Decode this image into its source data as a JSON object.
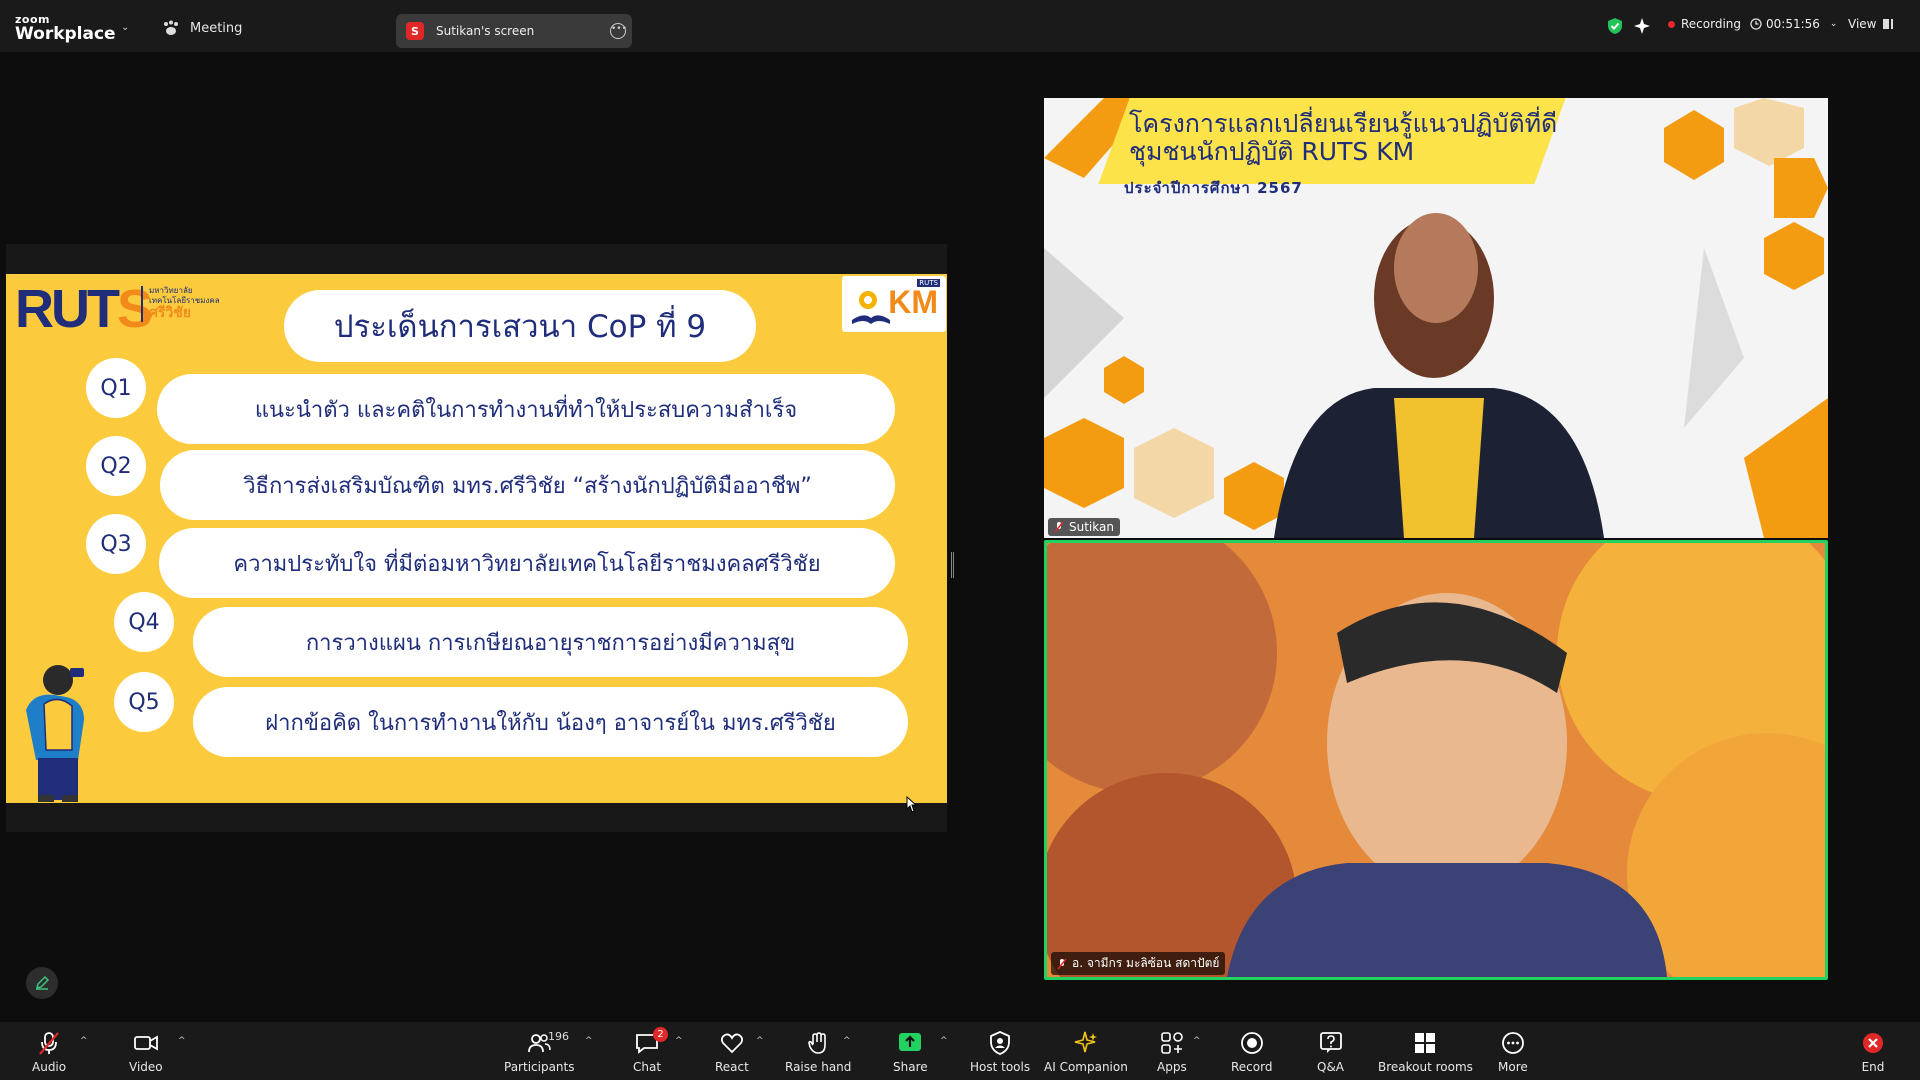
{
  "topbar": {
    "brand_small": "zoom",
    "brand_big": "Workplace",
    "meeting_label": "Meeting",
    "share_badge": "S",
    "share_label": "Sutikan's screen",
    "recording_label": "Recording",
    "timer": "00:51:56",
    "view_label": "View"
  },
  "slide": {
    "logo": "RUT",
    "logo_s": "S",
    "logo_sub1": "มหาวิทยาลัย",
    "logo_sub2": "เทคโนโลยีราชมงคล",
    "logo_sub3": "ศรีวิชัย",
    "km_tag": "RUTS",
    "km_text": "KM",
    "title": "ประเด็นการเสวนา CoP ที่ 9",
    "questions": [
      {
        "label": "Q1",
        "text": "แนะนำตัว และคติในการทำงานที่ทำให้ประสบความสำเร็จ"
      },
      {
        "label": "Q2",
        "text": "วิธีการส่งเสริมบัณฑิต มทร.ศรีวิชัย “สร้างนักปฏิบัติมืออาชีพ”"
      },
      {
        "label": "Q3",
        "text": "ความประทับใจ ที่มีต่อมหาวิทยาลัยเทคโนโลยีราชมงคลศรีวิชัย"
      },
      {
        "label": "Q4",
        "text": "การวางแผน การเกษียณอายุราชการอย่างมีความสุข"
      },
      {
        "label": "Q5",
        "text": "ฝากข้อคิด ในการทำงานให้กับ น้องๆ อาจารย์ใน มทร.ศรีวิชัย"
      }
    ]
  },
  "tiles": {
    "tile1": {
      "banner_line1": "โครงการแลกเปลี่ยนเรียนรู้แนวปฏิบัติที่ดี",
      "banner_line2": "ชุมชนนักปฏิบัติ RUTS KM",
      "banner_line3": "ประจำปีการศึกษา 2567",
      "name": "Sutikan"
    },
    "tile2": {
      "name": "อ. จามีกร มะลิซ้อน สดาปัตย์"
    }
  },
  "toolbar": {
    "audio": "Audio",
    "video": "Video",
    "participants": "Participants",
    "participants_count": "196",
    "chat": "Chat",
    "chat_badge": "2",
    "react": "React",
    "raise_hand": "Raise hand",
    "share": "Share",
    "host_tools": "Host tools",
    "ai_companion": "AI Companion",
    "apps": "Apps",
    "record": "Record",
    "qa": "Q&A",
    "breakout": "Breakout rooms",
    "more": "More",
    "end": "End"
  },
  "colors": {
    "slide_bg": "#fccb3d",
    "navy": "#1f2d7a",
    "orange": "#f28a19",
    "active_speaker": "#23d160",
    "recording_dot": "#e52b2b"
  }
}
